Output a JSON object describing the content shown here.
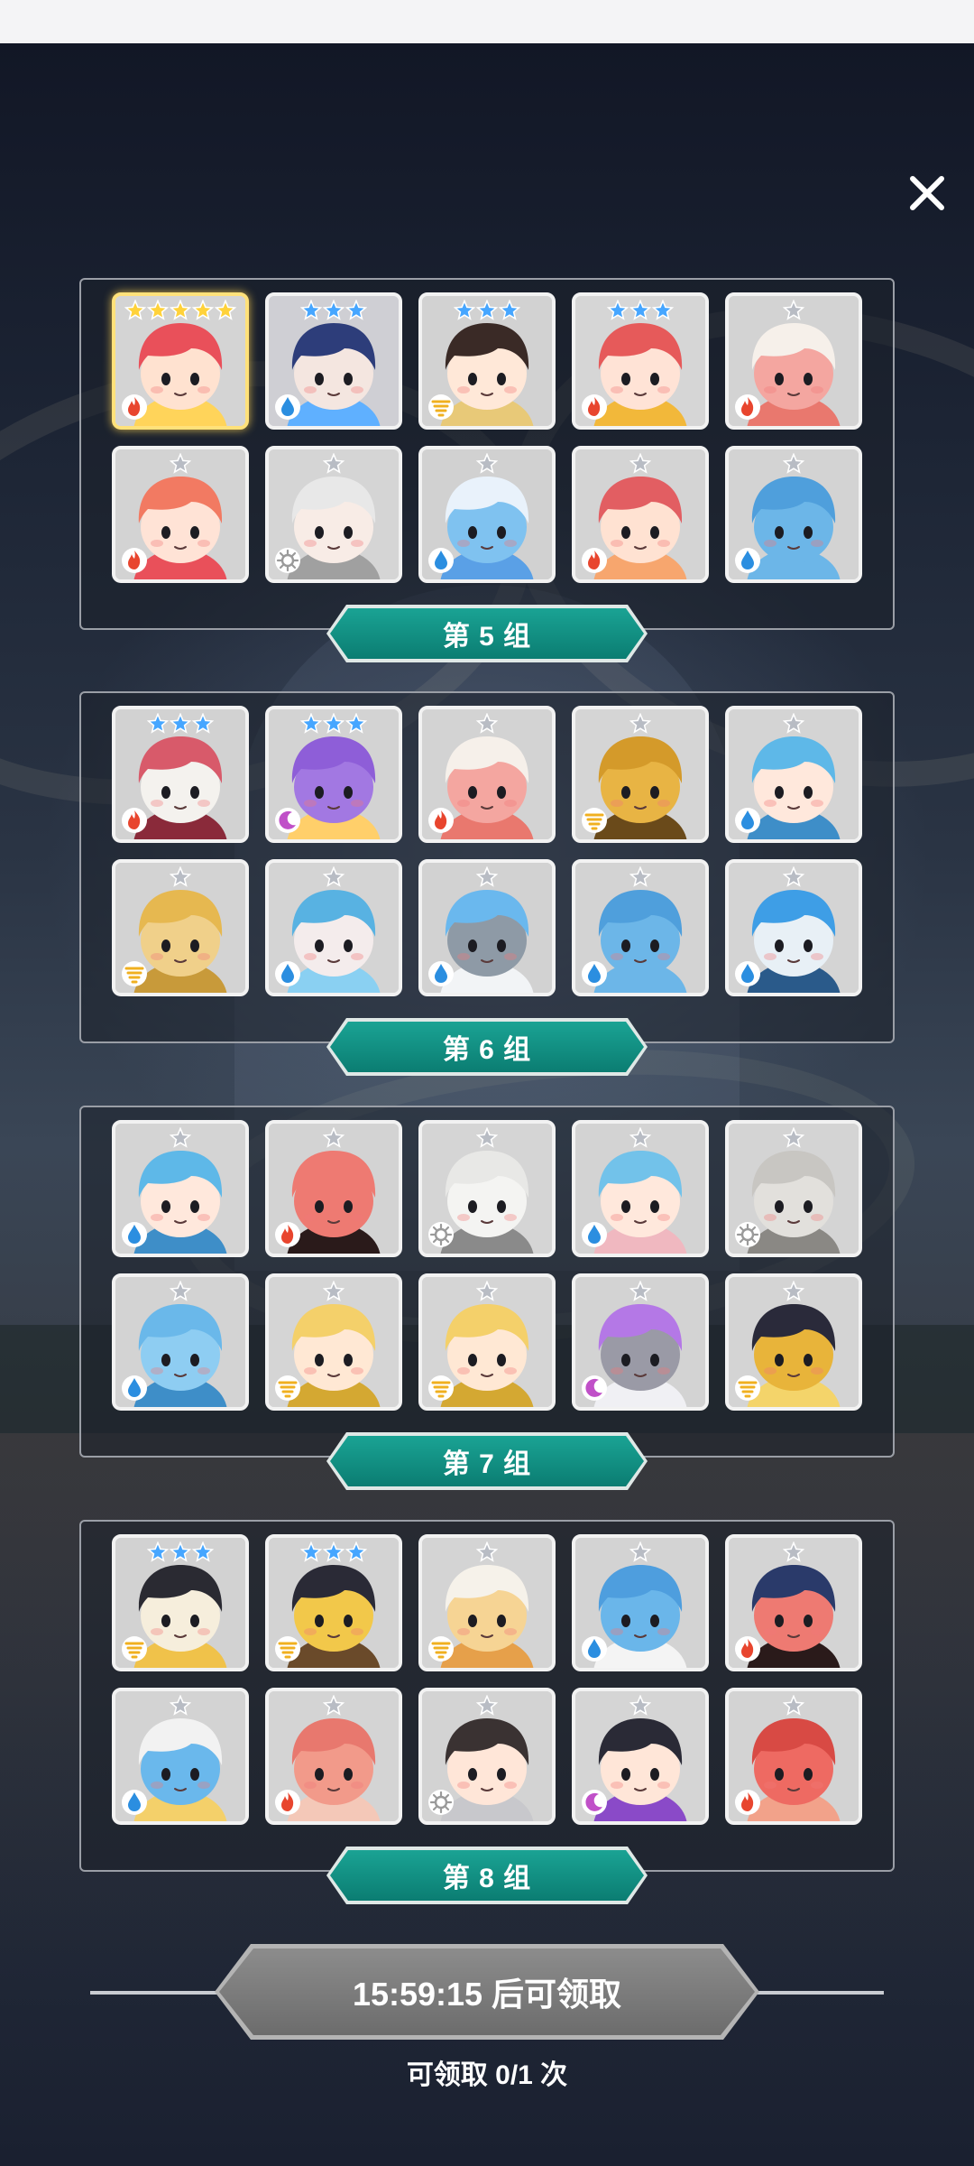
{
  "screen": {
    "close_label": "✕"
  },
  "groups": [
    {
      "label": "第 5 组",
      "heroes": [
        {
          "name": "red-hair-girl",
          "stars": 5,
          "star_color": "gold",
          "element": "fire",
          "bg": "#d4d4d4",
          "skin": "#ffe2d0",
          "hair": "#e9505a",
          "accent": "#ffd45a",
          "highlight": true
        },
        {
          "name": "dark-blue-warrior",
          "stars": 3,
          "star_color": "blue",
          "element": "water",
          "bg": "#cfcfd4",
          "skin": "#f4e6e0",
          "hair": "#2d3d7a",
          "accent": "#5fb0ff"
        },
        {
          "name": "black-hair-archer",
          "stars": 3,
          "star_color": "blue",
          "element": "wind",
          "bg": "#d2d2d2",
          "skin": "#ffe8d8",
          "hair": "#3a2a26",
          "accent": "#e8c978"
        },
        {
          "name": "crowned-queen",
          "stars": 3,
          "star_color": "blue",
          "element": "fire",
          "bg": "#d6d6d6",
          "skin": "#ffe3d6",
          "hair": "#e65a5a",
          "accent": "#f2b83a"
        },
        {
          "name": "bandaged-peach",
          "stars": 1,
          "star_color": "silver",
          "element": "fire",
          "bg": "#d3d3d3",
          "skin": "#f4a6a0",
          "hair": "#f6f0ea",
          "accent": "#e9786e"
        },
        {
          "name": "ribbon-girl",
          "stars": 1,
          "star_color": "silver",
          "element": "fire",
          "bg": "#d3d3d3",
          "skin": "#ffe3d6",
          "hair": "#f27a62",
          "accent": "#e9505a"
        },
        {
          "name": "white-hair-mage",
          "stars": 1,
          "star_color": "silver",
          "element": "light",
          "bg": "#d5d5d5",
          "skin": "#f8ece6",
          "hair": "#e8e8e8",
          "accent": "#a0a0a0"
        },
        {
          "name": "blue-spotted-shell",
          "stars": 1,
          "star_color": "silver",
          "element": "water",
          "bg": "#d1d1d1",
          "skin": "#7fc2f0",
          "hair": "#e9f2fb",
          "accent": "#5aa0e6"
        },
        {
          "name": "goggle-boy",
          "stars": 1,
          "star_color": "silver",
          "element": "fire",
          "bg": "#d4d4d4",
          "skin": "#ffe2d2",
          "hair": "#e25e62",
          "accent": "#f7a66e"
        },
        {
          "name": "blue-worm",
          "stars": 1,
          "star_color": "silver",
          "element": "water",
          "bg": "#d3d3d3",
          "skin": "#6cb6e8",
          "hair": "#4f9fdc",
          "accent": "#6cb6e8"
        }
      ]
    },
    {
      "label": "第 6 组",
      "heroes": [
        {
          "name": "horned-beast",
          "stars": 3,
          "star_color": "blue",
          "element": "fire",
          "bg": "#d2d2d2",
          "skin": "#f4f2ee",
          "hair": "#d85a6a",
          "accent": "#8a2a3a"
        },
        {
          "name": "purple-dragon",
          "stars": 3,
          "star_color": "blue",
          "element": "dark",
          "bg": "#d3d3d3",
          "skin": "#a278e2",
          "hair": "#8e5ed8",
          "accent": "#ffcf6a"
        },
        {
          "name": "bandaged-peach",
          "stars": 1,
          "star_color": "silver",
          "element": "fire",
          "bg": "#d3d3d3",
          "skin": "#f4a6a0",
          "hair": "#f6f0ea",
          "accent": "#e9786e"
        },
        {
          "name": "golden-tree",
          "stars": 1,
          "star_color": "silver",
          "element": "wind",
          "bg": "#d5d5d5",
          "skin": "#e8b444",
          "hair": "#d49a2a",
          "accent": "#6a4a1a"
        },
        {
          "name": "blue-ribbon-girl",
          "stars": 1,
          "star_color": "silver",
          "element": "water",
          "bg": "#d4d4d4",
          "skin": "#ffe8dc",
          "hair": "#5eb8e8",
          "accent": "#3e8ec8"
        },
        {
          "name": "golden-wolf",
          "stars": 1,
          "star_color": "silver",
          "element": "wind",
          "bg": "#d3d3d3",
          "skin": "#f0d08a",
          "hair": "#e6b850",
          "accent": "#c89a3a"
        },
        {
          "name": "ice-maiden",
          "stars": 1,
          "star_color": "silver",
          "element": "water",
          "bg": "#d4d4d4",
          "skin": "#f4ecec",
          "hair": "#58b2e2",
          "accent": "#8ad0f2"
        },
        {
          "name": "winged-knight",
          "stars": 1,
          "star_color": "silver",
          "element": "water",
          "bg": "#d2d2d2",
          "skin": "#8e9aa6",
          "hair": "#6ab8ee",
          "accent": "#f2f4f6"
        },
        {
          "name": "blue-worm",
          "stars": 1,
          "star_color": "silver",
          "element": "water",
          "bg": "#d3d3d3",
          "skin": "#6cb6e8",
          "hair": "#4f9fdc",
          "accent": "#6cb6e8"
        },
        {
          "name": "blue-robot",
          "stars": 1,
          "star_color": "silver",
          "element": "water",
          "bg": "#d4d4d4",
          "skin": "#e8f0f6",
          "hair": "#3e9ee6",
          "accent": "#2a5a8a"
        }
      ]
    },
    {
      "label": "第 7 组",
      "heroes": [
        {
          "name": "blue-ribbon-girl",
          "stars": 1,
          "star_color": "silver",
          "element": "water",
          "bg": "#d4d4d4",
          "skin": "#ffe8dc",
          "hair": "#5eb8e8",
          "accent": "#3e8ec8"
        },
        {
          "name": "red-octopus",
          "stars": 1,
          "star_color": "silver",
          "element": "fire",
          "bg": "#d3d3d3",
          "skin": "#ee7a72",
          "hair": "#ee7a72",
          "accent": "#2a1a1a"
        },
        {
          "name": "white-ghost",
          "stars": 1,
          "star_color": "silver",
          "element": "light",
          "bg": "#d5d5d5",
          "skin": "#f4f4f2",
          "hair": "#e8e8e6",
          "accent": "#8a8a8a"
        },
        {
          "name": "blue-cat-girl",
          "stars": 1,
          "star_color": "silver",
          "element": "water",
          "bg": "#d3d3d3",
          "skin": "#ffe8dc",
          "hair": "#72c2ea",
          "accent": "#f0b8c0"
        },
        {
          "name": "stone-shell",
          "stars": 1,
          "star_color": "silver",
          "element": "light",
          "bg": "#d4d4d4",
          "skin": "#e2e0dc",
          "hair": "#c8c6c2",
          "accent": "#8a8884"
        },
        {
          "name": "blue-golem",
          "stars": 1,
          "star_color": "silver",
          "element": "water",
          "bg": "#d3d3d3",
          "skin": "#8ecdf2",
          "hair": "#6ab8ea",
          "accent": "#3e8ec8"
        },
        {
          "name": "golden-antlers",
          "stars": 1,
          "star_color": "silver",
          "element": "wind",
          "bg": "#d5d5d5",
          "skin": "#ffe8d4",
          "hair": "#f4d06a",
          "accent": "#d4a832"
        },
        {
          "name": "golden-antlers",
          "stars": 1,
          "star_color": "silver",
          "element": "wind",
          "bg": "#d5d5d5",
          "skin": "#ffe8d4",
          "hair": "#f4d06a",
          "accent": "#d4a832"
        },
        {
          "name": "purple-knight",
          "stars": 1,
          "star_color": "silver",
          "element": "dark",
          "bg": "#d3d3d3",
          "skin": "#9a9aa6",
          "hair": "#b478e6",
          "accent": "#f0f0f4"
        },
        {
          "name": "treasure-chest",
          "stars": 1,
          "star_color": "silver",
          "element": "wind",
          "bg": "#d4d4d4",
          "skin": "#e8b43a",
          "hair": "#2a2a3a",
          "accent": "#f4d46a"
        }
      ]
    },
    {
      "label": "第 8 组",
      "heroes": [
        {
          "name": "bandaged-mummy",
          "stars": 3,
          "star_color": "blue",
          "element": "wind",
          "bg": "#d2d2d2",
          "skin": "#f6eedc",
          "hair": "#2a2a32",
          "accent": "#f0c24a"
        },
        {
          "name": "pyramid-eye",
          "stars": 3,
          "star_color": "blue",
          "element": "wind",
          "bg": "#d3d3d3",
          "skin": "#f2c84a",
          "hair": "#2a2a36",
          "accent": "#6a4a2a"
        },
        {
          "name": "bandaged-hamster",
          "stars": 1,
          "star_color": "silver",
          "element": "wind",
          "bg": "#d4d4d4",
          "skin": "#f6d494",
          "hair": "#f6f2ea",
          "accent": "#e6a04a"
        },
        {
          "name": "blue-cactus",
          "stars": 1,
          "star_color": "silver",
          "element": "water",
          "bg": "#d3d3d3",
          "skin": "#6ab6ea",
          "hair": "#4e9ede",
          "accent": "#f4f4f4"
        },
        {
          "name": "red-skull-pirate",
          "stars": 1,
          "star_color": "silver",
          "element": "fire",
          "bg": "#d4d4d4",
          "skin": "#ee7a72",
          "hair": "#2a3a6a",
          "accent": "#2a1a1a"
        },
        {
          "name": "blue-bear",
          "stars": 1,
          "star_color": "silver",
          "element": "water",
          "bg": "#d3d3d3",
          "skin": "#6ab8ec",
          "hair": "#f2f2f2",
          "accent": "#f4d06a"
        },
        {
          "name": "pink-shell",
          "stars": 1,
          "star_color": "silver",
          "element": "fire",
          "bg": "#d4d4d4",
          "skin": "#f29a8a",
          "hair": "#e8786e",
          "accent": "#f4c8b8"
        },
        {
          "name": "armored-knight",
          "stars": 1,
          "star_color": "silver",
          "element": "light",
          "bg": "#d3d3d3",
          "skin": "#ffe6d8",
          "hair": "#3a3232",
          "accent": "#c8c8cc"
        },
        {
          "name": "card-mage",
          "stars": 1,
          "star_color": "silver",
          "element": "dark",
          "bg": "#d5d5d5",
          "skin": "#ffe6d8",
          "hair": "#2a2a36",
          "accent": "#8a4ac8"
        },
        {
          "name": "red-worm",
          "stars": 1,
          "star_color": "silver",
          "element": "fire",
          "bg": "#d3d3d3",
          "skin": "#ee6a62",
          "hair": "#d84a44",
          "accent": "#f2a28a"
        }
      ]
    }
  ],
  "footer": {
    "timer_label": "15:59:15 后可领取",
    "claim_count_label": "可领取 0/1 次"
  },
  "colors": {
    "fire": "#e8452e",
    "water": "#2b8ee0",
    "wind": "#f0b020",
    "light": "#e8e8e8",
    "dark": "#c050c8",
    "star_gold": "#ffd23a",
    "star_blue": "#46a6ff",
    "star_silver": "#b8bcc4",
    "tab_teal": "#0f8a7e"
  }
}
